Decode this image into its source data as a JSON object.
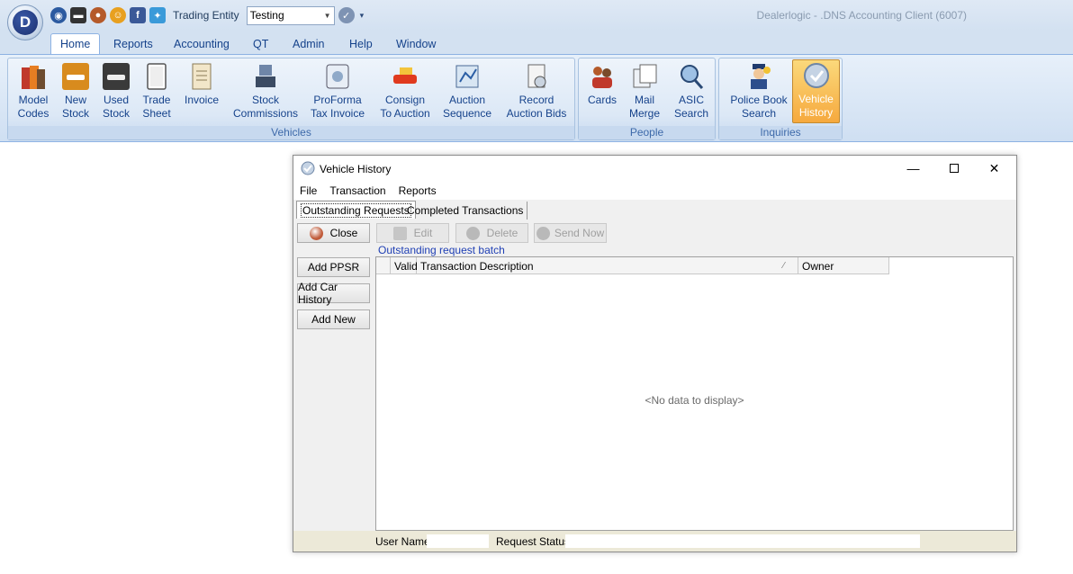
{
  "app": {
    "window_title": "Dealerlogic - .DNS Accounting Client (6007)",
    "orb_letter": "D"
  },
  "quick_access": {
    "icons": [
      "globe-icon",
      "car-icon",
      "users-icon",
      "smiley-icon",
      "facebook-icon",
      "twitter-icon"
    ],
    "trading_entity_label": "Trading Entity",
    "trading_entity_value": "Testing"
  },
  "ribbon_tabs": [
    "Home",
    "Reports",
    "Accounting",
    "QT",
    "Admin",
    "Help",
    "Window"
  ],
  "ribbon": {
    "vehicles": {
      "label": "Vehicles",
      "buttons": [
        {
          "line1": "Model",
          "line2": "Codes"
        },
        {
          "line1": "New",
          "line2": "Stock"
        },
        {
          "line1": "Used",
          "line2": "Stock"
        },
        {
          "line1": "Trade",
          "line2": "Sheet"
        },
        {
          "line1": "Invoice",
          "line2": ""
        },
        {
          "line1": "Stock",
          "line2": "Commissions"
        },
        {
          "line1": "ProForma",
          "line2": "Tax Invoice"
        },
        {
          "line1": "Consign",
          "line2": "To Auction"
        },
        {
          "line1": "Auction",
          "line2": "Sequence"
        },
        {
          "line1": "Record",
          "line2": "Auction Bids"
        }
      ]
    },
    "people": {
      "label": "People",
      "buttons": [
        {
          "line1": "Cards",
          "line2": ""
        },
        {
          "line1": "Mail",
          "line2": "Merge"
        },
        {
          "line1": "ASIC",
          "line2": "Search"
        }
      ]
    },
    "inquiries": {
      "label": "Inquiries",
      "buttons": [
        {
          "line1": "Police Book",
          "line2": "Search"
        },
        {
          "line1": "Vehicle",
          "line2": "History"
        }
      ]
    }
  },
  "child_window": {
    "title": "Vehicle History",
    "menu": [
      "File",
      "Transaction",
      "Reports"
    ],
    "tabs": [
      "Outstanding Requests",
      "Completed Transactions"
    ],
    "toolbar": {
      "close": "Close",
      "edit": "Edit",
      "delete": "Delete",
      "send_now": "Send Now"
    },
    "batch_label": "Outstanding request batch",
    "side_buttons": [
      "Add PPSR",
      "Add Car History",
      "Add New"
    ],
    "grid": {
      "columns": [
        "Valid",
        "Transaction Description",
        "Owner"
      ],
      "empty_text": "<No data to display>"
    },
    "status": {
      "user_name_label": "User Name",
      "user_name_value": "",
      "request_status_label": "Request Status",
      "request_status_value": ""
    }
  },
  "colors": {
    "ribbon_text": "#15428b",
    "selected_button": "#f6a93e",
    "batch_label": "#1f3fb4"
  }
}
